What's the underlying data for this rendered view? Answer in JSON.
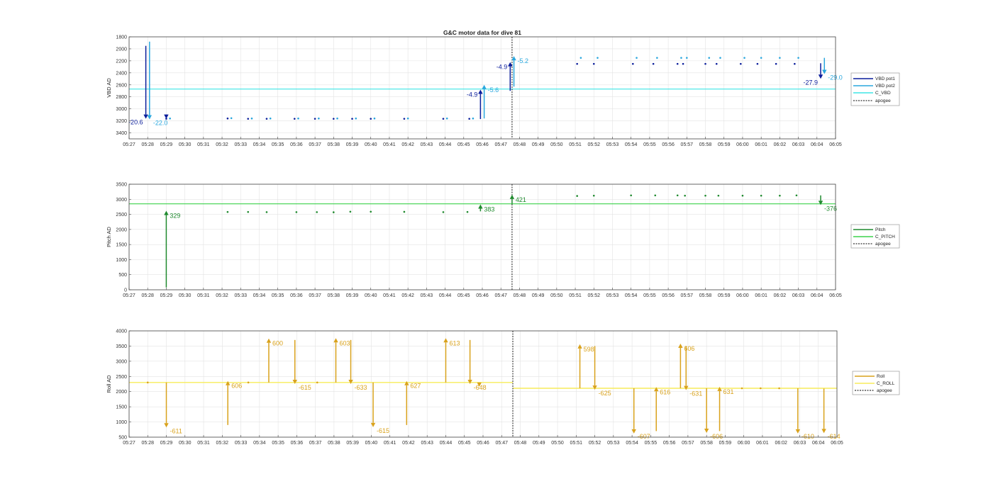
{
  "figure": {
    "title": "G&C motor data for dive 81"
  },
  "time_ticks": [
    "05:27",
    "05:28",
    "05:29",
    "05:30",
    "05:31",
    "05:32",
    "05:33",
    "05:34",
    "05:35",
    "05:36",
    "05:37",
    "05:38",
    "05:39",
    "05:40",
    "05:41",
    "05:42",
    "05:43",
    "05:44",
    "05:45",
    "05:46",
    "05:47",
    "05:48",
    "05:49",
    "05:50",
    "05:51",
    "05:52",
    "05:53",
    "05:54",
    "05:55",
    "05:56",
    "05:57",
    "05:58",
    "05:59",
    "06:00",
    "06:01",
    "06:02",
    "06:03",
    "06:04",
    "06:05"
  ],
  "colors": {
    "vbd_pot1": "#0a1d9b",
    "vbd_pot2": "#2aa7de",
    "c_vbd": "#3ee6e6",
    "pitch": "#1f8a2e",
    "c_pitch": "#3bd24c",
    "roll": "#d9a21c",
    "c_roll": "#f7ec5a",
    "apogee": "#000000"
  },
  "chart_data": [
    {
      "type": "line",
      "ylabel": "VBD AD",
      "xlim": [
        "05:27",
        "06:05"
      ],
      "ylim": [
        1800,
        3500
      ],
      "y_reversed": true,
      "y_ticks": [
        1800,
        2000,
        2200,
        2400,
        2600,
        2800,
        3000,
        3200,
        3400
      ],
      "grid": true,
      "legend": {
        "placement": "right",
        "entries": [
          "VBD pot1",
          "VBD pot2",
          "C_VBD",
          "apogee"
        ]
      },
      "apogee_time": "05:47.6",
      "reference_line": {
        "name": "C_VBD",
        "value": 2670
      },
      "series": [
        {
          "name": "VBD pot1",
          "points": [
            [
              "05:29.0",
              3165
            ],
            [
              "05:32.3",
              3160
            ],
            [
              "05:33.4",
              3165
            ],
            [
              "05:34.4",
              3165
            ],
            [
              "05:35.9",
              3165
            ],
            [
              "05:37.0",
              3165
            ],
            [
              "05:38.0",
              3165
            ],
            [
              "05:39.0",
              3165
            ],
            [
              "05:40.0",
              3165
            ],
            [
              "05:41.8",
              3165
            ],
            [
              "05:43.9",
              3165
            ],
            [
              "05:45.3",
              3165
            ],
            [
              "05:51.1",
              2250
            ],
            [
              "05:52.0",
              2250
            ],
            [
              "05:54.1",
              2250
            ],
            [
              "05:55.2",
              2250
            ],
            [
              "05:56.5",
              2250
            ],
            [
              "05:56.8",
              2250
            ],
            [
              "05:58.0",
              2250
            ],
            [
              "05:58.6",
              2250
            ],
            [
              "05:59.9",
              2250
            ],
            [
              "06:00.8",
              2250
            ],
            [
              "06:01.8",
              2250
            ],
            [
              "06:02.8",
              2250
            ]
          ]
        },
        {
          "name": "VBD pot2",
          "points": [
            [
              "05:29.2",
              3160
            ],
            [
              "05:32.5",
              3155
            ],
            [
              "05:33.6",
              3160
            ],
            [
              "05:34.6",
              3160
            ],
            [
              "05:36.1",
              3160
            ],
            [
              "05:37.2",
              3160
            ],
            [
              "05:38.2",
              3160
            ],
            [
              "05:39.2",
              3160
            ],
            [
              "05:40.2",
              3160
            ],
            [
              "05:42.0",
              3160
            ],
            [
              "05:44.1",
              3160
            ],
            [
              "05:45.5",
              3160
            ],
            [
              "05:51.3",
              2150
            ],
            [
              "05:52.2",
              2150
            ],
            [
              "05:54.3",
              2150
            ],
            [
              "05:55.4",
              2150
            ],
            [
              "05:56.7",
              2150
            ],
            [
              "05:57.0",
              2150
            ],
            [
              "05:58.2",
              2150
            ],
            [
              "05:58.8",
              2150
            ],
            [
              "06:00.1",
              2150
            ],
            [
              "06:01.0",
              2150
            ],
            [
              "06:02.0",
              2150
            ],
            [
              "06:03.0",
              2150
            ]
          ]
        }
      ],
      "moves": [
        {
          "series": "VBD pot1",
          "t": "05:27.9",
          "from": 1950,
          "to": 3165,
          "label": "-20.6"
        },
        {
          "series": "VBD pot2",
          "t": "05:28.1",
          "from": 1880,
          "to": 3175,
          "label": "-22.0"
        },
        {
          "series": "VBD pot1",
          "t": "05:29.0",
          "from": 3160,
          "to": 3165,
          "label": ""
        },
        {
          "series": "VBD pot1",
          "t": "05:45.9",
          "from": 3170,
          "to": 2680,
          "label": "-4.9"
        },
        {
          "series": "VBD pot2",
          "t": "05:46.1",
          "from": 3160,
          "to": 2600,
          "label": "-5.6"
        },
        {
          "series": "VBD pot1",
          "t": "05:47.5",
          "from": 2700,
          "to": 2220,
          "label": "-4.9"
        },
        {
          "series": "VBD pot2",
          "t": "05:47.7",
          "from": 2630,
          "to": 2120,
          "label": "-5.2"
        },
        {
          "series": "VBD pot1",
          "t": "06:04.2",
          "from": 2240,
          "to": 2500,
          "label": "-27.9"
        },
        {
          "series": "VBD pot2",
          "t": "06:04.4",
          "from": 2150,
          "to": 2420,
          "label": "-29.0"
        }
      ]
    },
    {
      "type": "line",
      "ylabel": "Pitch AD",
      "xlim": [
        "05:27",
        "06:05"
      ],
      "ylim": [
        0,
        3500
      ],
      "y_ticks": [
        0,
        500,
        1000,
        1500,
        2000,
        2500,
        3000,
        3500
      ],
      "grid": true,
      "legend": {
        "placement": "right",
        "entries": [
          "Pitch",
          "C_PITCH",
          "apogee"
        ]
      },
      "apogee_time": "05:47.6",
      "reference_line": {
        "name": "C_PITCH",
        "value": 2850
      },
      "series": [
        {
          "name": "Pitch",
          "points": [
            [
              "05:32.3",
              2580
            ],
            [
              "05:33.4",
              2580
            ],
            [
              "05:34.4",
              2575
            ],
            [
              "05:36.0",
              2575
            ],
            [
              "05:37.1",
              2575
            ],
            [
              "05:38.0",
              2570
            ],
            [
              "05:38.9",
              2590
            ],
            [
              "05:40.0",
              2590
            ],
            [
              "05:41.8",
              2585
            ],
            [
              "05:43.9",
              2575
            ],
            [
              "05:45.2",
              2580
            ],
            [
              "05:51.1",
              3110
            ],
            [
              "05:52.0",
              3120
            ],
            [
              "05:54.0",
              3130
            ],
            [
              "05:55.3",
              3130
            ],
            [
              "05:56.5",
              3130
            ],
            [
              "05:56.9",
              3120
            ],
            [
              "05:58.0",
              3120
            ],
            [
              "05:58.7",
              3120
            ],
            [
              "06:00.0",
              3120
            ],
            [
              "06:01.0",
              3120
            ],
            [
              "06:02.0",
              3120
            ],
            [
              "06:02.9",
              3130
            ]
          ]
        }
      ],
      "moves": [
        {
          "series": "Pitch",
          "t": "05:29.0",
          "from": 80,
          "to": 2620,
          "label": "329"
        },
        {
          "series": "Pitch",
          "t": "05:45.9",
          "from": 2600,
          "to": 2830,
          "label": "383"
        },
        {
          "series": "Pitch",
          "t": "05:47.6",
          "from": 2850,
          "to": 3150,
          "label": "421"
        },
        {
          "series": "Pitch",
          "t": "06:04.2",
          "from": 3130,
          "to": 2810,
          "label": "-376"
        }
      ]
    },
    {
      "type": "line",
      "ylabel": "Roll AD",
      "xlim": [
        "05:27",
        "06:05"
      ],
      "ylim": [
        500,
        4000
      ],
      "y_ticks": [
        500,
        1000,
        1500,
        2000,
        2500,
        3000,
        3500,
        4000
      ],
      "grid": true,
      "legend": {
        "placement": "right",
        "entries": [
          "Roll",
          "C_ROLL",
          "apogee"
        ]
      },
      "apogee_time": "05:47.6",
      "reference_segments": [
        {
          "name": "C_ROLL",
          "from": "05:27.0",
          "to": "05:47.6",
          "value": 2300
        },
        {
          "name": "C_ROLL",
          "from": "05:47.6",
          "to": "06:05.0",
          "value": 2110
        }
      ],
      "series": [
        {
          "name": "Roll",
          "points": [
            [
              "05:28.0",
              2300
            ],
            [
              "05:33.4",
              2300
            ],
            [
              "05:37.1",
              2300
            ],
            [
              "05:59.9",
              2110
            ],
            [
              "06:00.9",
              2110
            ],
            [
              "06:01.9",
              2110
            ]
          ]
        }
      ],
      "moves": [
        {
          "series": "Roll",
          "t": "05:29.0",
          "from": 2300,
          "to": 820,
          "label": "-611"
        },
        {
          "series": "Roll",
          "t": "05:32.3",
          "from": 900,
          "to": 2350,
          "label": "606"
        },
        {
          "series": "Roll",
          "t": "05:34.5",
          "from": 2300,
          "to": 3750,
          "label": "600"
        },
        {
          "series": "Roll",
          "t": "05:35.9",
          "from": 3700,
          "to": 2250,
          "label": "-615"
        },
        {
          "series": "Roll",
          "t": "05:38.1",
          "from": 2300,
          "to": 3760,
          "label": "603"
        },
        {
          "series": "Roll",
          "t": "05:38.9",
          "from": 3700,
          "to": 2250,
          "label": "-633"
        },
        {
          "series": "Roll",
          "t": "05:40.1",
          "from": 2300,
          "to": 830,
          "label": "-615"
        },
        {
          "series": "Roll",
          "t": "05:41.9",
          "from": 900,
          "to": 2350,
          "label": "627"
        },
        {
          "series": "Roll",
          "t": "05:44.0",
          "from": 2300,
          "to": 3760,
          "label": "613"
        },
        {
          "series": "Roll",
          "t": "05:45.3",
          "from": 3700,
          "to": 2250,
          "label": "-648"
        },
        {
          "series": "Roll",
          "t": "05:45.8",
          "from": 2200,
          "to": 2160,
          "label": ""
        },
        {
          "series": "Roll",
          "t": "05:51.2",
          "from": 2110,
          "to": 3560,
          "label": "598"
        },
        {
          "series": "Roll",
          "t": "05:52.0",
          "from": 3500,
          "to": 2060,
          "label": "-625"
        },
        {
          "series": "Roll",
          "t": "05:54.1",
          "from": 2110,
          "to": 620,
          "label": "-607"
        },
        {
          "series": "Roll",
          "t": "05:55.3",
          "from": 700,
          "to": 2150,
          "label": "616"
        },
        {
          "series": "Roll",
          "t": "05:56.6",
          "from": 2110,
          "to": 3580,
          "label": "606"
        },
        {
          "series": "Roll",
          "t": "05:56.9",
          "from": 3500,
          "to": 2050,
          "label": "-631"
        },
        {
          "series": "Roll",
          "t": "05:58.0",
          "from": 2110,
          "to": 640,
          "label": "-606"
        },
        {
          "series": "Roll",
          "t": "05:58.7",
          "from": 700,
          "to": 2160,
          "label": "631"
        },
        {
          "series": "Roll",
          "t": "06:02.9",
          "from": 2110,
          "to": 620,
          "label": "-610"
        },
        {
          "series": "Roll",
          "t": "06:04.3",
          "from": 2100,
          "to": 630,
          "label": "-614"
        }
      ]
    }
  ]
}
